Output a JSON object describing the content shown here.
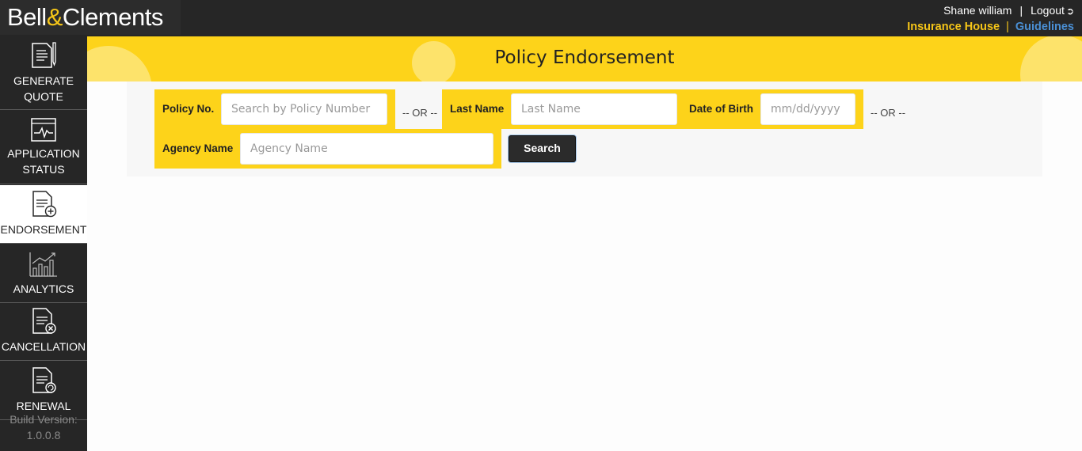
{
  "header": {
    "logo_left": "Bell",
    "logo_amp": "&",
    "logo_right": "Clements",
    "user_name": "Shane william",
    "separator": "|",
    "logout_label": "Logout",
    "insurance_house": "Insurance House",
    "guidelines": "Guidelines"
  },
  "sidebar": {
    "items": [
      {
        "line1": "GENERATE",
        "line2": "QUOTE",
        "icon": "quote-document-icon"
      },
      {
        "line1": "APPLICATION",
        "line2": "STATUS",
        "icon": "status-monitor-icon"
      },
      {
        "line1": "ENDORSEMENT",
        "line2": "",
        "icon": "document-add-icon"
      },
      {
        "line1": "ANALYTICS",
        "line2": "",
        "icon": "analytics-chart-icon"
      },
      {
        "line1": "CANCELLATION",
        "line2": "",
        "icon": "document-cancel-icon"
      },
      {
        "line1": "RENEWAL",
        "line2": "",
        "icon": "document-renew-icon"
      }
    ],
    "active": "ENDORSEMENT",
    "build_label": "Build Version:",
    "build_version": "1.0.0.8"
  },
  "page": {
    "title": "Policy Endorsement"
  },
  "search": {
    "policy_label": "Policy No.",
    "policy_placeholder": "Search by Policy Number",
    "or_text": "-- OR --",
    "last_name_label": "Last Name",
    "last_name_placeholder": "Last Name",
    "dob_label": "Date of Birth",
    "dob_placeholder": "mm/dd/yyyy",
    "or_text_2": "-- OR --",
    "agency_label": "Agency Name",
    "agency_placeholder": "Agency Name",
    "search_button": "Search"
  },
  "colors": {
    "accent_yellow": "#fdd31a",
    "dark": "#262626",
    "link_blue": "#4a8fd4"
  }
}
